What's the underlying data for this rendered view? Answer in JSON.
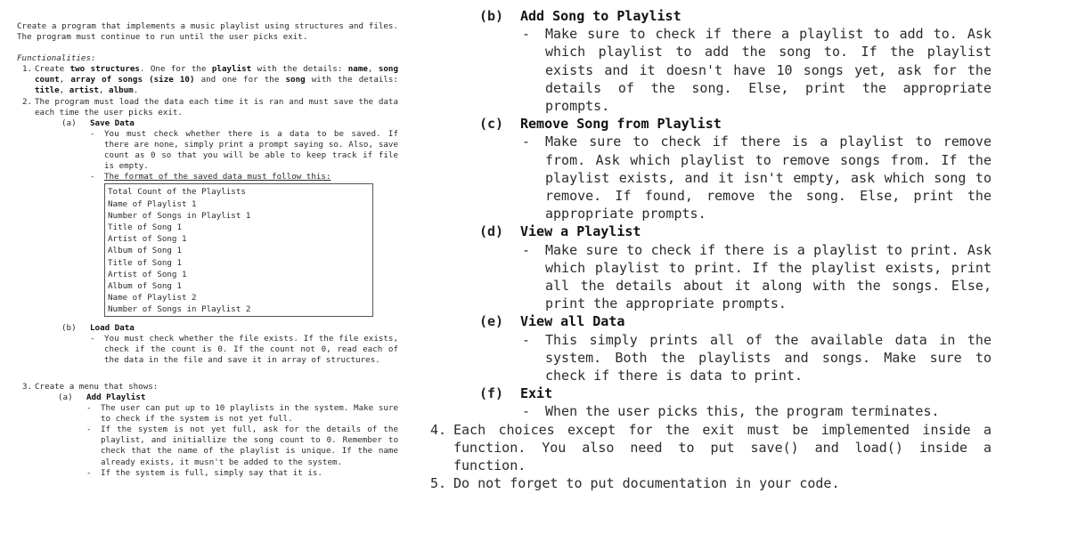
{
  "left": {
    "intro": "Create a program that implements a music playlist using structures and files. The program must continue to run until the user picks exit.",
    "functionalities_label": "Functionalities:",
    "item1": {
      "num": "1.",
      "t1": "Create ",
      "b1": "two structures",
      "t2": ". One for the ",
      "b2": "playlist",
      "t3": " with the details: ",
      "b3": "name",
      "t4": ", ",
      "b4": "song count",
      "t5": ", ",
      "b5": "array of songs (size 10)",
      "t6": " and one for the ",
      "b6": "song",
      "t7": " with the details: ",
      "b7": "title",
      "t8": ", ",
      "b8": "artist",
      "t9": ", ",
      "b9": "album",
      "t10": "."
    },
    "item2": {
      "num": "2.",
      "text": "The program must load the data each time it is ran and must save the data each time the user picks exit.",
      "save": {
        "letter": "(a)",
        "heading": "Save Data",
        "bullet1": "You must check whether there is a data to be saved. If there are none, simply print a prompt saying so. Also, save count as 0 so that you will be able to keep track if file is empty.",
        "bullet2": "The format of the saved data must follow this:",
        "format_lines": [
          "Total Count of the Playlists",
          "Name of Playlist 1",
          "Number of Songs in Playlist 1",
          "Title of Song 1",
          "Artist of Song 1",
          "Album of Song 1",
          "Title of Song 1",
          "Artist of Song 1",
          "Album of Song 1",
          "Name of Playlist 2",
          "Number of Songs in Playlist 2"
        ]
      },
      "load": {
        "letter": "(b)",
        "heading": "Load Data",
        "bullet1": "You must check whether the file exists. If the file exists, check if the count is 0. If the count not 0, read each of the data in the file and save it in array of structures."
      }
    },
    "item3": {
      "num": "3.",
      "text": "Create a menu that shows:",
      "add_playlist": {
        "letter": "(a)",
        "heading": "Add Playlist",
        "bullet1": "The user can put up to 10 playlists in the system. Make sure to check if the system is not yet full.",
        "bullet2": "If the system is not yet full, ask for the details of the playlist, and initiallize the song count to 0. Remember to check that the name of the playlist is unique. If the name already exists, it musn't be added to the system.",
        "bullet3": "If the system is full, simply say that it is."
      }
    }
  },
  "right": {
    "add_song": {
      "letter": "(b)",
      "heading": "Add Song to Playlist",
      "bullet": "Make sure to check if there a playlist to add to. Ask which playlist to add the song to. If the playlist exists and it doesn't have 10 songs yet, ask for the details of the song. Else, print the appropriate prompts."
    },
    "remove_song": {
      "letter": "(c)",
      "heading": "Remove Song from Playlist",
      "bullet": "Make sure to check if there is a playlist to remove from. Ask which playlist to remove songs from. If the playlist exists, and it isn't empty, ask which song to remove. If found, remove the song. Else, print the appropriate prompts."
    },
    "view_playlist": {
      "letter": "(d)",
      "heading": "View a Playlist",
      "bullet": "Make sure to check if there is a playlist to print. Ask which playlist to print. If the playlist exists, print all the details about it along with the songs. Else, print the appropriate prompts."
    },
    "view_all": {
      "letter": "(e)",
      "heading": "View all Data",
      "bullet": "This simply prints all of the available data in the system. Both the playlists and songs. Make sure to check if there is data to print."
    },
    "exit": {
      "letter": "(f)",
      "heading": "Exit",
      "bullet": "When the user picks this, the program terminates."
    },
    "item4": {
      "num": "4.",
      "text": "Each choices except for the exit must be implemented inside a function. You also need to put save() and load() inside a function."
    },
    "item5": {
      "num": "5.",
      "text": "Do not forget to put documentation in your code."
    },
    "dash": "-"
  }
}
